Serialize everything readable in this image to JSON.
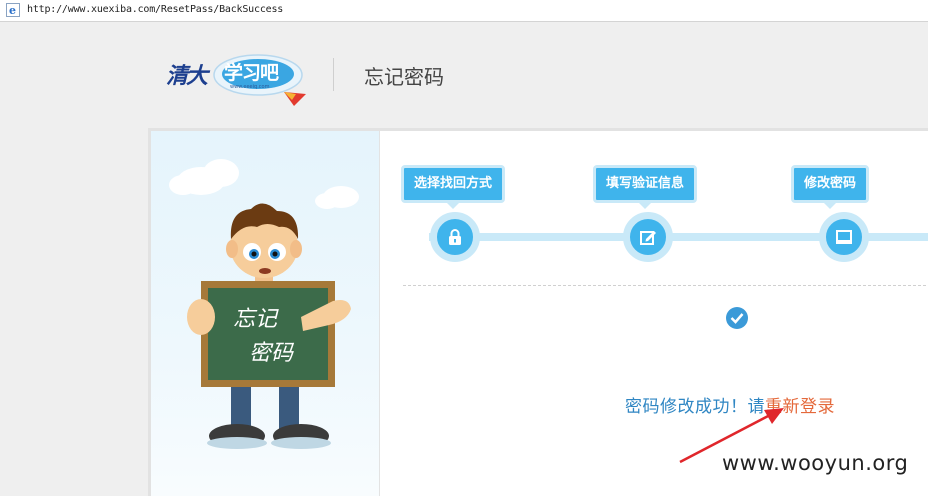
{
  "browser": {
    "url": "http://www.xuexiba.com/ResetPass/BackSuccess"
  },
  "header": {
    "logo_brand": "清大",
    "logo_product": "学习吧",
    "logo_url": "www.eeeiq.com",
    "page_title": "忘记密码"
  },
  "illustration": {
    "board_line1": "忘记",
    "board_line2": "密码"
  },
  "steps": [
    {
      "label": "选择找回方式",
      "icon": "lock-icon"
    },
    {
      "label": "填写验证信息",
      "icon": "edit-icon"
    },
    {
      "label": "修改密码",
      "icon": "monitor-icon"
    }
  ],
  "result": {
    "message": "密码修改成功！请",
    "relogin_link": "重新登录"
  },
  "watermark": "www.wooyun.org",
  "colors": {
    "accent": "#3fb4ec",
    "track": "#c9e9f8",
    "message": "#2f86c3",
    "link": "#e4693b",
    "annotation_arrow": "#e0262b"
  }
}
